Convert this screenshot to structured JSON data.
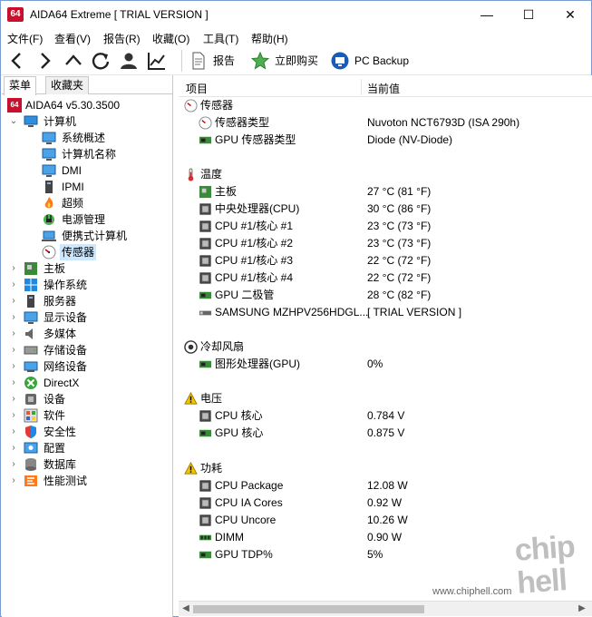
{
  "window": {
    "icon_text": "64",
    "title": "AIDA64 Extreme  [ TRIAL VERSION ]",
    "minimize": "—",
    "maximize": "☐",
    "close": "✕"
  },
  "menu": [
    "文件(F)",
    "查看(V)",
    "报告(R)",
    "收藏(O)",
    "工具(T)",
    "帮助(H)"
  ],
  "toolbar": {
    "report_label": "报告",
    "buy_label": "立即购买",
    "backup_label": "PC Backup"
  },
  "left_tabs": [
    "菜单",
    "收藏夹"
  ],
  "tree": {
    "root": "AIDA64 v5.30.3500",
    "computer": "计算机",
    "computer_children": [
      "系统概述",
      "计算机名称",
      "DMI",
      "IPMI",
      "超频",
      "电源管理",
      "便携式计算机",
      "传感器"
    ],
    "top_items": [
      "主板",
      "操作系统",
      "服务器",
      "显示设备",
      "多媒体",
      "存储设备",
      "网络设备",
      "DirectX",
      "设备",
      "软件",
      "安全性",
      "配置",
      "数据库",
      "性能测试"
    ]
  },
  "columns": {
    "item": "项目",
    "value": "当前值"
  },
  "sections": {
    "sensor": {
      "title": "传感器",
      "rows": [
        {
          "k": "传感器类型",
          "v": "Nuvoton NCT6793D  (ISA 290h)"
        },
        {
          "k": "GPU 传感器类型",
          "v": "Diode  (NV-Diode)"
        }
      ]
    },
    "temp": {
      "title": "温度",
      "rows": [
        {
          "k": "主板",
          "v": "27 °C  (81 °F)"
        },
        {
          "k": "中央处理器(CPU)",
          "v": "30 °C  (86 °F)"
        },
        {
          "k": "CPU #1/核心 #1",
          "v": "23 °C  (73 °F)"
        },
        {
          "k": "CPU #1/核心 #2",
          "v": "23 °C  (73 °F)"
        },
        {
          "k": "CPU #1/核心 #3",
          "v": "22 °C  (72 °F)"
        },
        {
          "k": "CPU #1/核心 #4",
          "v": "22 °C  (72 °F)"
        },
        {
          "k": "GPU 二极管",
          "v": "28 °C  (82 °F)"
        },
        {
          "k": "SAMSUNG MZHPV256HDGL...",
          "v": "[ TRIAL VERSION ]"
        }
      ]
    },
    "fan": {
      "title": "冷却风扇",
      "rows": [
        {
          "k": "图形处理器(GPU)",
          "v": "0%"
        }
      ]
    },
    "volt": {
      "title": "电压",
      "rows": [
        {
          "k": "CPU 核心",
          "v": "0.784 V"
        },
        {
          "k": "GPU 核心",
          "v": "0.875 V"
        }
      ]
    },
    "power": {
      "title": "功耗",
      "rows": [
        {
          "k": "CPU Package",
          "v": "12.08 W"
        },
        {
          "k": "CPU IA Cores",
          "v": "0.92 W"
        },
        {
          "k": "CPU Uncore",
          "v": "10.26 W"
        },
        {
          "k": "DIMM",
          "v": "0.90 W"
        },
        {
          "k": "GPU TDP%",
          "v": "5%"
        }
      ]
    }
  },
  "watermark": {
    "url": "www.chiphell.com",
    "logo": "chip hell"
  }
}
